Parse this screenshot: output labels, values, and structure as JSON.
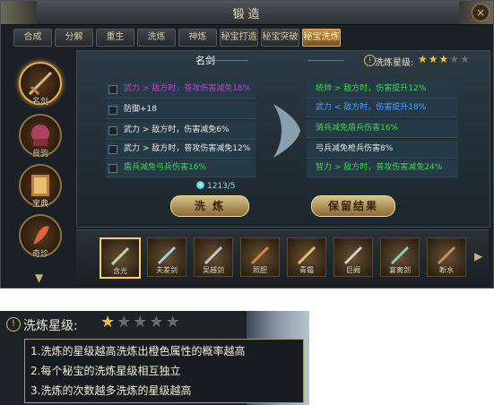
{
  "window": {
    "title": "锻造",
    "close": "×"
  },
  "tabs": [
    {
      "label": "合成"
    },
    {
      "label": "分解"
    },
    {
      "label": "重生"
    },
    {
      "label": "洗炼"
    },
    {
      "label": "神炼"
    },
    {
      "label": "秘宝打造"
    },
    {
      "label": "秘宝突破"
    },
    {
      "label": "秘宝洗炼"
    }
  ],
  "categories": [
    {
      "label": "名剑"
    },
    {
      "label": "良驹"
    },
    {
      "label": "宝典"
    },
    {
      "label": "奇珍"
    }
  ],
  "main": {
    "weapon_name": "名剑",
    "star_label": "洗炼星级:",
    "star_rating": 3,
    "star_max": 5,
    "left_attrs": [
      {
        "text": "武力 > 敌方时，普攻伤害减免18%",
        "color": "purple"
      },
      {
        "text": "防御+18",
        "color": "white"
      },
      {
        "text": "武力 > 敌方时，伤害减免6%",
        "color": "white"
      },
      {
        "text": "武力 > 敌方时，普攻伤害减免12%",
        "color": "white"
      },
      {
        "text": "盾兵减免弓兵伤害16%",
        "color": "green"
      }
    ],
    "right_attrs": [
      {
        "text": "统帅 > 敌方时，伤害提升12%",
        "color": "green"
      },
      {
        "text": "武力 < 敌方时，伤害提升18%",
        "color": "blue"
      },
      {
        "text": "骑兵减免盾兵伤害16%",
        "color": "green"
      },
      {
        "text": "弓兵减免枪兵伤害8%",
        "color": "white"
      },
      {
        "text": "智力 > 敌方时，普攻伤害减免24%",
        "color": "green"
      }
    ],
    "cost": "1213/5",
    "wash_button": "洗 炼",
    "keep_button": "保留结果"
  },
  "items": [
    {
      "label": "含光"
    },
    {
      "label": "夫差剑"
    },
    {
      "label": "吴越剑"
    },
    {
      "label": "照胆"
    },
    {
      "label": "青霜"
    },
    {
      "label": "巨阙"
    },
    {
      "label": "宴离剑"
    },
    {
      "label": "断水"
    }
  ],
  "tooltip": {
    "label": "洗炼星级:",
    "star_rating": 1,
    "star_max": 5,
    "lines": [
      "1.洗炼的星级越高洗炼出橙色属性的概率越高",
      "2.每个秘宝的洗炼星级相互独立",
      "3.洗炼的次数越多洗炼的星级越高"
    ]
  },
  "colors": {
    "purple": "#c040d0",
    "white": "#e8e8e8",
    "green": "#3ed94a",
    "blue": "#4aa0ff",
    "orange": "#ff8a20",
    "star_on": "#f0c030",
    "star_off": "#6a6a6a"
  }
}
